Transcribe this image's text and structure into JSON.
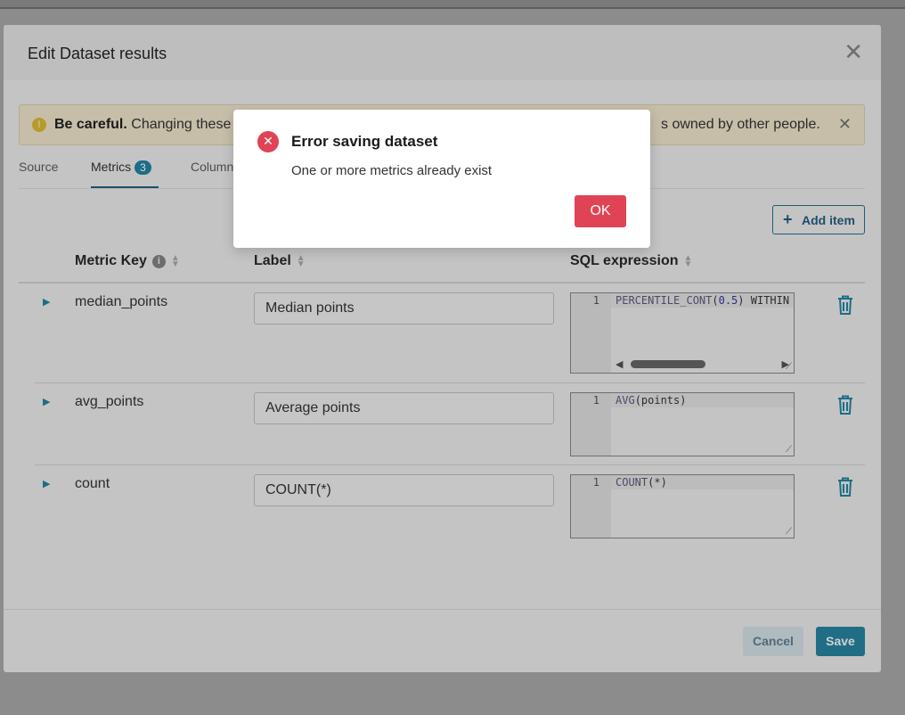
{
  "modal": {
    "title": "Edit Dataset results",
    "close_glyph": "✕"
  },
  "alert": {
    "icon": "!",
    "bold": "Be careful.",
    "text": " Changing these",
    "tail": "s owned by other people.",
    "close_glyph": "✕"
  },
  "tabs": [
    {
      "label": "Source"
    },
    {
      "label": "Metrics",
      "badge": "3"
    },
    {
      "label": "Column"
    }
  ],
  "add_item": {
    "icon": "+",
    "label": "Add item"
  },
  "table": {
    "headers": {
      "metric_key": "Metric Key",
      "label": "Label",
      "sql": "SQL expression"
    },
    "info_glyph": "i",
    "rows": [
      {
        "key": "median_points",
        "label": "Median points",
        "line": "1",
        "sql": "PERCENTILE_CONT(0.5) WITHIN"
      },
      {
        "key": "avg_points",
        "label": "Average points",
        "line": "1",
        "sql": "AVG(points)"
      },
      {
        "key": "count",
        "label": "COUNT(*)",
        "line": "1",
        "sql": "COUNT(*)"
      }
    ]
  },
  "footer": {
    "cancel": "Cancel",
    "save": "Save"
  },
  "error": {
    "title": "Error saving dataset",
    "message": "One or more metrics already exist",
    "ok": "OK",
    "icon_glyph": "✕"
  },
  "colors": {
    "accent": "#1f6e85",
    "danger": "#e04355",
    "warning": "#b89a2b"
  }
}
